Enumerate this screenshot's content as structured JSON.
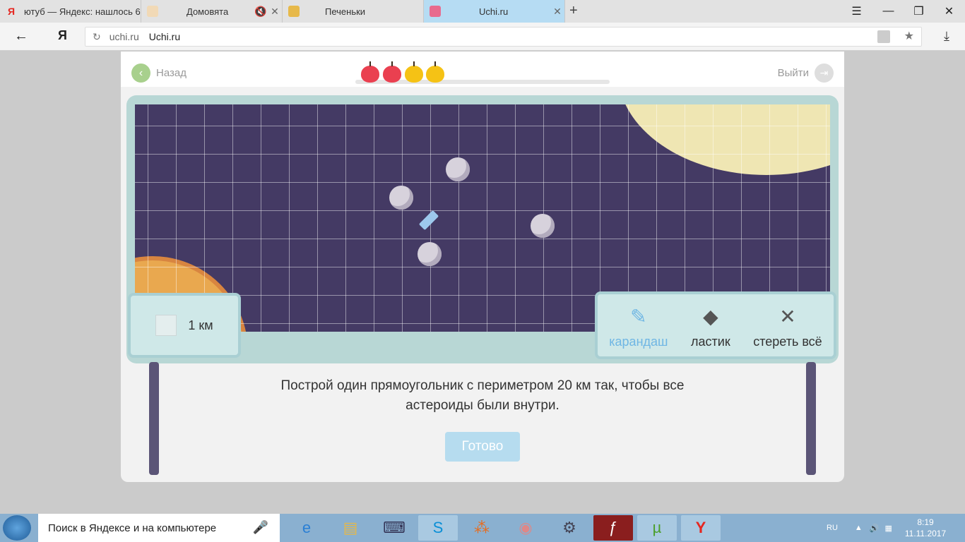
{
  "browser": {
    "tabs": [
      {
        "title": "ютуб — Яндекс: нашлось 6",
        "fav_color": "#ffffff"
      },
      {
        "title": "Домовята",
        "fav_color": "#ffffff"
      },
      {
        "title": "Печеньки",
        "fav_color": "#e7b94a"
      },
      {
        "title": "Uchi.ru",
        "fav_color": "#e86b8e",
        "active": true
      }
    ],
    "url_domain": "uchi.ru",
    "url_title": "Uchi.ru",
    "logo": "Я"
  },
  "game": {
    "back_label": "Назад",
    "exit_label": "Выйти",
    "apples": [
      {
        "color": "#ea4050"
      },
      {
        "color": "#ea4050"
      },
      {
        "color": "#f5c215"
      },
      {
        "color": "#f5c215"
      }
    ],
    "scale_label": "1 км",
    "tools": {
      "pencil": "карандаш",
      "eraser": "ластик",
      "clear": "стереть всё"
    },
    "task_line1": "Построй один прямоугольник с периметром 20 км так, чтобы все",
    "task_line2": "астероиды были внутри.",
    "done_label": "Готово"
  },
  "taskbar": {
    "search_text": "Поиск в Яндексе и на компьютере",
    "lang": "RU",
    "time": "8:19",
    "date": "11.11.2017"
  }
}
